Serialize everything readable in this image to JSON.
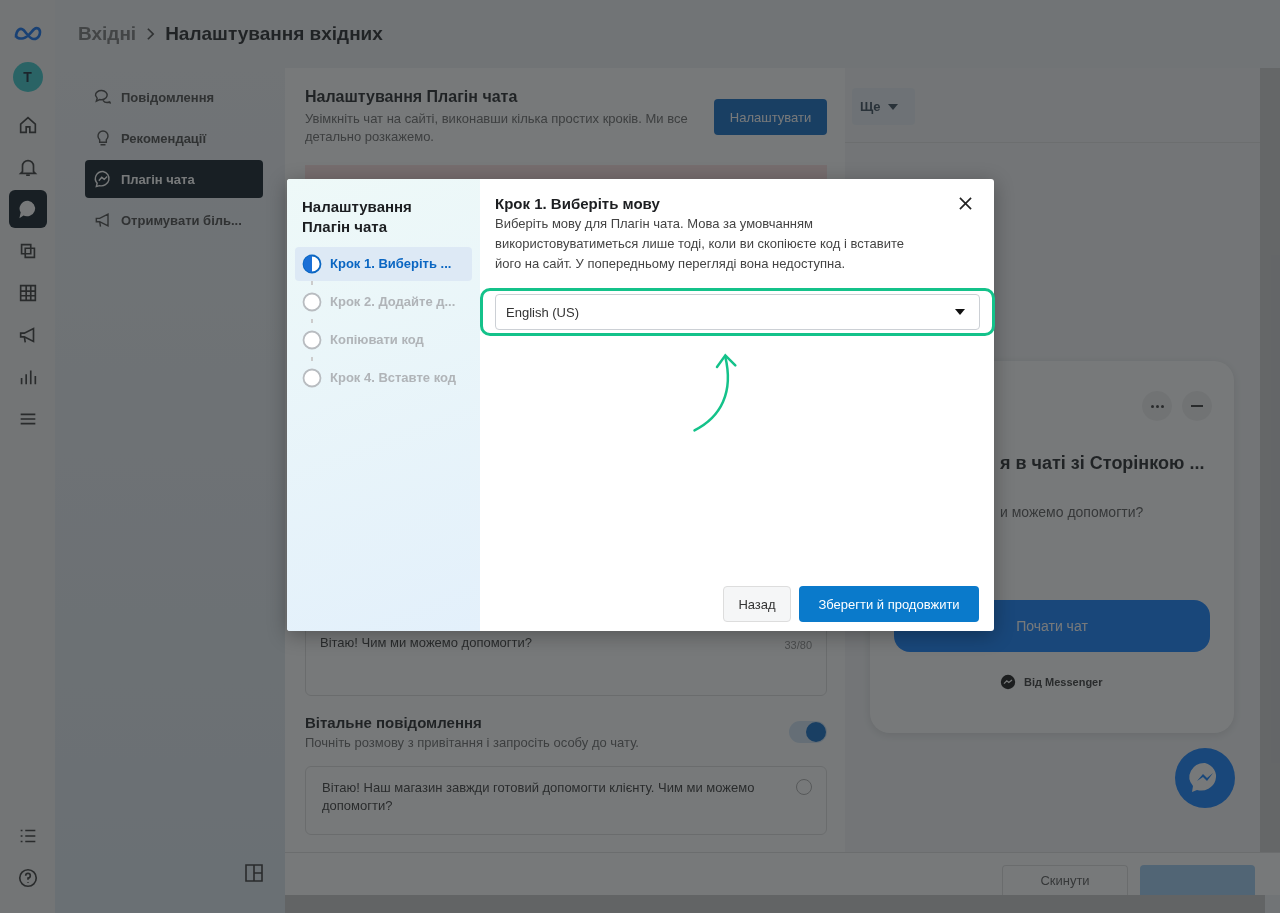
{
  "rail": {
    "avatar": "T",
    "items": [
      {
        "kind": "home",
        "selected": false
      },
      {
        "kind": "bell",
        "selected": false
      },
      {
        "kind": "chat",
        "selected": true
      },
      {
        "kind": "pages",
        "selected": false
      },
      {
        "kind": "grid",
        "selected": false
      },
      {
        "kind": "megaphone",
        "selected": false
      },
      {
        "kind": "chart",
        "selected": false
      },
      {
        "kind": "menu",
        "selected": false
      }
    ],
    "bottom": [
      {
        "kind": "list"
      },
      {
        "kind": "help"
      }
    ]
  },
  "breadcrumb": {
    "parent": "Вхідні",
    "current": "Налаштування вхідних"
  },
  "sidebar": {
    "items": [
      {
        "kind": "chats",
        "label": "Повідомлення",
        "selected": false
      },
      {
        "kind": "bulb",
        "label": "Рекомендації",
        "selected": false
      },
      {
        "kind": "messenger",
        "label": "Плагін чата",
        "selected": true
      },
      {
        "kind": "megaphone",
        "label": "Отримувати біль...",
        "selected": false
      }
    ]
  },
  "panel": {
    "title": "Налаштування Плагін чата",
    "description": "Увімкніть чат на сайті, виконавши кілька простих кроків. Ми все детально розкажемо.",
    "action": "Налаштувати",
    "default_message": {
      "text": "Вітаю! Чим ми можемо допомогти?",
      "counter": "33/80"
    },
    "welcome": {
      "title": "Вітальне повідомлення",
      "description": "Почніть розмову з привітання і запросіть особу до чату.",
      "on": true,
      "message": "Вітаю! Наш магазин завжди готовий допомогти клієнту. Чим ми можемо допомогти?"
    },
    "footer": {
      "reset": "Скинути"
    }
  },
  "preview": {
    "more": "Ще",
    "chat_title": "я в чаті зі Сторінкою ...",
    "chat_text": "и можемо допомогти?",
    "start": "Почати чат",
    "by": "Від Messenger"
  },
  "modal": {
    "title": "Налаштування Плагін чата",
    "steps": [
      {
        "label": "Крок 1. Виберіть ...",
        "selected": true
      },
      {
        "label": "Крок 2. Додайте д...",
        "selected": false
      },
      {
        "label": "Копіювати код",
        "selected": false
      },
      {
        "label": "Крок 4. Вставте код",
        "selected": false
      }
    ],
    "heading": "Крок 1. Виберіть мову",
    "text": "Виберіть мову для Плагін чата. Мова за умовчанням використовуватиметься лише тоді, коли ви скопіюєте код і вставите його на сайт. У попередньому перегляді вона недоступна.",
    "language": "English (US)",
    "back": "Назад",
    "next": "Зберегти й продовжити"
  }
}
